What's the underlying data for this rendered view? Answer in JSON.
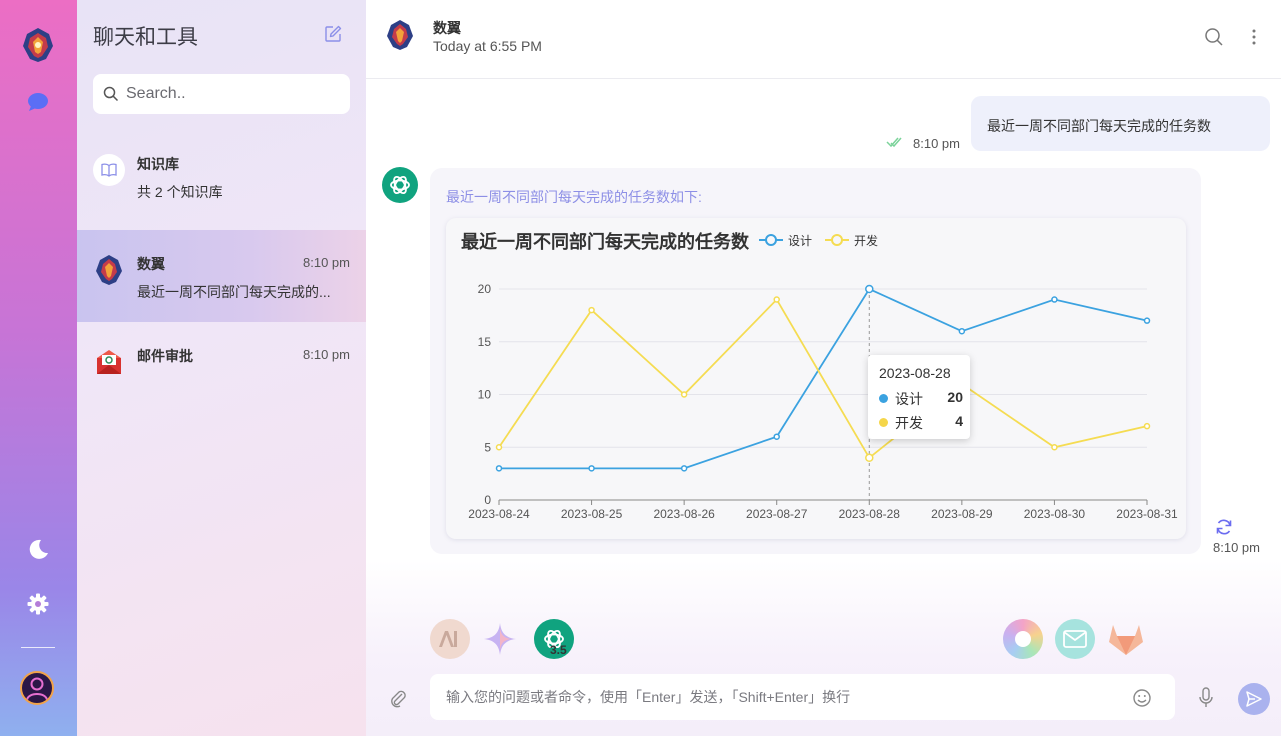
{
  "sidebar": {
    "title": "聊天和工具",
    "search_placeholder": "Search..",
    "items": [
      {
        "name": "知识库",
        "sub": "共 2 个知识库",
        "icon": "book-icon"
      },
      {
        "name": "数翼",
        "time": "8:10 pm",
        "sub": "最近一周不同部门每天完成的...",
        "icon": "shield-logo-icon"
      },
      {
        "name": "邮件审批",
        "time": "8:10 pm",
        "icon": "mail-approval-icon"
      }
    ]
  },
  "header": {
    "name": "数翼",
    "subtitle": "Today at 6:55 PM"
  },
  "messages": {
    "user": {
      "text": "最近一周不同部门每天完成的任务数",
      "time": "8:10 pm"
    },
    "bot": {
      "intro": "最近一周不同部门每天完成的任务数如下:",
      "time": "8:10 pm"
    }
  },
  "tooltip": {
    "date": "2023-08-28",
    "rows": [
      {
        "name": "设计",
        "value": "20"
      },
      {
        "name": "开发",
        "value": "4"
      }
    ]
  },
  "composer": {
    "placeholder": "输入您的问题或者命令，使用「Enter」发送，「Shift+Enter」换行",
    "model_badge": "3.5"
  },
  "colors": {
    "design": "#3ba2e0",
    "dev": "#f5dc52",
    "accent": "#6b6cf0"
  },
  "chart_data": {
    "type": "line",
    "title": "最近一周不同部门每天完成的任务数",
    "categories": [
      "2023-08-24",
      "2023-08-25",
      "2023-08-26",
      "2023-08-27",
      "2023-08-28",
      "2023-08-29",
      "2023-08-30",
      "2023-08-31"
    ],
    "series": [
      {
        "name": "设计",
        "values": [
          3,
          3,
          3,
          6,
          20,
          16,
          19,
          17
        ]
      },
      {
        "name": "开发",
        "values": [
          5,
          18,
          10,
          19,
          4,
          11,
          5,
          7
        ]
      }
    ],
    "ylim": [
      0,
      20
    ],
    "yticks": [
      0,
      5,
      10,
      15,
      20
    ],
    "grid": true,
    "legend": "top"
  }
}
